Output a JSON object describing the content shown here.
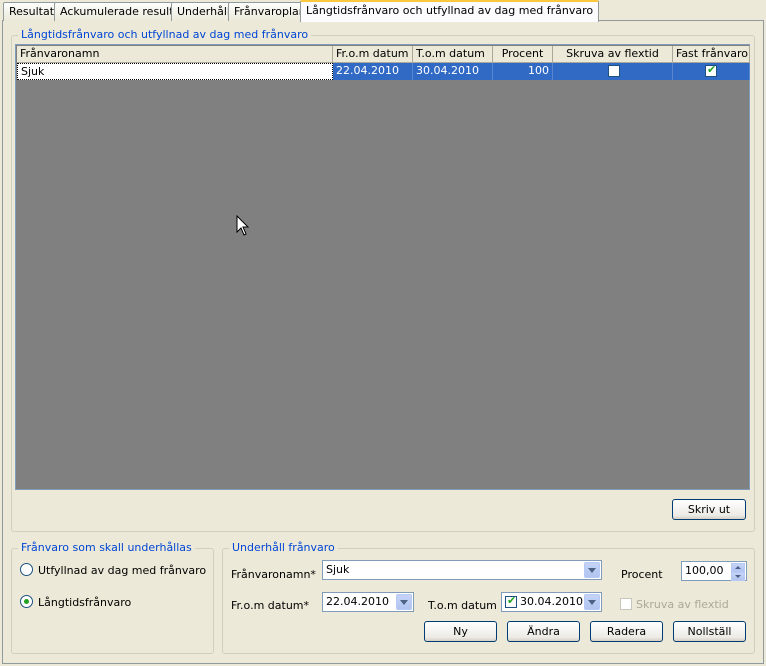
{
  "tabs": [
    {
      "label": "Resultat"
    },
    {
      "label": "Ackumulerade resultat"
    },
    {
      "label": "Underhåll"
    },
    {
      "label": "Frånvaroplan"
    },
    {
      "label": "Långtidsfrånvaro och utfyllnad av dag med frånvaro"
    }
  ],
  "list_group": {
    "title": "Långtidsfrånvaro och utfyllnad av dag med frånvaro",
    "columns": [
      "Frånvaronamn",
      "Fr.o.m datum",
      "T.o.m datum",
      "Procent",
      "Skruva av flextid",
      "Fast frånvaro"
    ],
    "rows": [
      {
        "name": "Sjuk",
        "from": "22.04.2010",
        "to": "30.04.2010",
        "percent": "100",
        "flextime_off": false,
        "fixed_absence": true
      }
    ],
    "print_label": "Skriv ut"
  },
  "maintain_group": {
    "title": "Frånvaro som skall underhållas",
    "options": [
      {
        "label": "Utfyllnad av dag med frånvaro",
        "checked": false
      },
      {
        "label": "Långtidsfrånvaro",
        "checked": true
      }
    ]
  },
  "edit_group": {
    "title": "Underhåll frånvaro",
    "name_label": "Frånvaronamn*",
    "name_value": "Sjuk",
    "percent_label": "Procent",
    "percent_value": "100,00",
    "from_label": "Fr.o.m datum*",
    "from_value": "22.04.2010",
    "to_label": "T.o.m datum",
    "to_value": "30.04.2010",
    "to_checked": true,
    "flextime_label": "Skruva av flextid",
    "flextime_checked": false,
    "buttons": {
      "new": "Ny",
      "edit": "Ändra",
      "delete": "Radera",
      "reset": "Nollställ"
    }
  },
  "colors": {
    "accent": "#0046d5",
    "selection": "#316ac5",
    "grid_bg": "#808080",
    "check": "#21a121"
  }
}
